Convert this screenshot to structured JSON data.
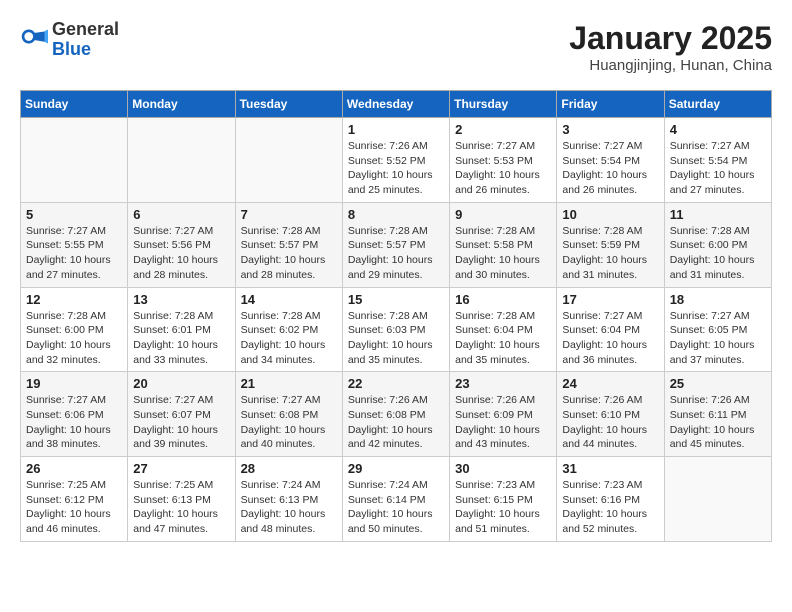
{
  "header": {
    "logo_general": "General",
    "logo_blue": "Blue",
    "title": "January 2025",
    "subtitle": "Huangjinjing, Hunan, China"
  },
  "weekdays": [
    "Sunday",
    "Monday",
    "Tuesday",
    "Wednesday",
    "Thursday",
    "Friday",
    "Saturday"
  ],
  "weeks": [
    [
      {
        "day": "",
        "sunrise": "",
        "sunset": "",
        "daylight": ""
      },
      {
        "day": "",
        "sunrise": "",
        "sunset": "",
        "daylight": ""
      },
      {
        "day": "",
        "sunrise": "",
        "sunset": "",
        "daylight": ""
      },
      {
        "day": "1",
        "sunrise": "Sunrise: 7:26 AM",
        "sunset": "Sunset: 5:52 PM",
        "daylight": "Daylight: 10 hours and 25 minutes."
      },
      {
        "day": "2",
        "sunrise": "Sunrise: 7:27 AM",
        "sunset": "Sunset: 5:53 PM",
        "daylight": "Daylight: 10 hours and 26 minutes."
      },
      {
        "day": "3",
        "sunrise": "Sunrise: 7:27 AM",
        "sunset": "Sunset: 5:54 PM",
        "daylight": "Daylight: 10 hours and 26 minutes."
      },
      {
        "day": "4",
        "sunrise": "Sunrise: 7:27 AM",
        "sunset": "Sunset: 5:54 PM",
        "daylight": "Daylight: 10 hours and 27 minutes."
      }
    ],
    [
      {
        "day": "5",
        "sunrise": "Sunrise: 7:27 AM",
        "sunset": "Sunset: 5:55 PM",
        "daylight": "Daylight: 10 hours and 27 minutes."
      },
      {
        "day": "6",
        "sunrise": "Sunrise: 7:27 AM",
        "sunset": "Sunset: 5:56 PM",
        "daylight": "Daylight: 10 hours and 28 minutes."
      },
      {
        "day": "7",
        "sunrise": "Sunrise: 7:28 AM",
        "sunset": "Sunset: 5:57 PM",
        "daylight": "Daylight: 10 hours and 28 minutes."
      },
      {
        "day": "8",
        "sunrise": "Sunrise: 7:28 AM",
        "sunset": "Sunset: 5:57 PM",
        "daylight": "Daylight: 10 hours and 29 minutes."
      },
      {
        "day": "9",
        "sunrise": "Sunrise: 7:28 AM",
        "sunset": "Sunset: 5:58 PM",
        "daylight": "Daylight: 10 hours and 30 minutes."
      },
      {
        "day": "10",
        "sunrise": "Sunrise: 7:28 AM",
        "sunset": "Sunset: 5:59 PM",
        "daylight": "Daylight: 10 hours and 31 minutes."
      },
      {
        "day": "11",
        "sunrise": "Sunrise: 7:28 AM",
        "sunset": "Sunset: 6:00 PM",
        "daylight": "Daylight: 10 hours and 31 minutes."
      }
    ],
    [
      {
        "day": "12",
        "sunrise": "Sunrise: 7:28 AM",
        "sunset": "Sunset: 6:00 PM",
        "daylight": "Daylight: 10 hours and 32 minutes."
      },
      {
        "day": "13",
        "sunrise": "Sunrise: 7:28 AM",
        "sunset": "Sunset: 6:01 PM",
        "daylight": "Daylight: 10 hours and 33 minutes."
      },
      {
        "day": "14",
        "sunrise": "Sunrise: 7:28 AM",
        "sunset": "Sunset: 6:02 PM",
        "daylight": "Daylight: 10 hours and 34 minutes."
      },
      {
        "day": "15",
        "sunrise": "Sunrise: 7:28 AM",
        "sunset": "Sunset: 6:03 PM",
        "daylight": "Daylight: 10 hours and 35 minutes."
      },
      {
        "day": "16",
        "sunrise": "Sunrise: 7:28 AM",
        "sunset": "Sunset: 6:04 PM",
        "daylight": "Daylight: 10 hours and 35 minutes."
      },
      {
        "day": "17",
        "sunrise": "Sunrise: 7:27 AM",
        "sunset": "Sunset: 6:04 PM",
        "daylight": "Daylight: 10 hours and 36 minutes."
      },
      {
        "day": "18",
        "sunrise": "Sunrise: 7:27 AM",
        "sunset": "Sunset: 6:05 PM",
        "daylight": "Daylight: 10 hours and 37 minutes."
      }
    ],
    [
      {
        "day": "19",
        "sunrise": "Sunrise: 7:27 AM",
        "sunset": "Sunset: 6:06 PM",
        "daylight": "Daylight: 10 hours and 38 minutes."
      },
      {
        "day": "20",
        "sunrise": "Sunrise: 7:27 AM",
        "sunset": "Sunset: 6:07 PM",
        "daylight": "Daylight: 10 hours and 39 minutes."
      },
      {
        "day": "21",
        "sunrise": "Sunrise: 7:27 AM",
        "sunset": "Sunset: 6:08 PM",
        "daylight": "Daylight: 10 hours and 40 minutes."
      },
      {
        "day": "22",
        "sunrise": "Sunrise: 7:26 AM",
        "sunset": "Sunset: 6:08 PM",
        "daylight": "Daylight: 10 hours and 42 minutes."
      },
      {
        "day": "23",
        "sunrise": "Sunrise: 7:26 AM",
        "sunset": "Sunset: 6:09 PM",
        "daylight": "Daylight: 10 hours and 43 minutes."
      },
      {
        "day": "24",
        "sunrise": "Sunrise: 7:26 AM",
        "sunset": "Sunset: 6:10 PM",
        "daylight": "Daylight: 10 hours and 44 minutes."
      },
      {
        "day": "25",
        "sunrise": "Sunrise: 7:26 AM",
        "sunset": "Sunset: 6:11 PM",
        "daylight": "Daylight: 10 hours and 45 minutes."
      }
    ],
    [
      {
        "day": "26",
        "sunrise": "Sunrise: 7:25 AM",
        "sunset": "Sunset: 6:12 PM",
        "daylight": "Daylight: 10 hours and 46 minutes."
      },
      {
        "day": "27",
        "sunrise": "Sunrise: 7:25 AM",
        "sunset": "Sunset: 6:13 PM",
        "daylight": "Daylight: 10 hours and 47 minutes."
      },
      {
        "day": "28",
        "sunrise": "Sunrise: 7:24 AM",
        "sunset": "Sunset: 6:13 PM",
        "daylight": "Daylight: 10 hours and 48 minutes."
      },
      {
        "day": "29",
        "sunrise": "Sunrise: 7:24 AM",
        "sunset": "Sunset: 6:14 PM",
        "daylight": "Daylight: 10 hours and 50 minutes."
      },
      {
        "day": "30",
        "sunrise": "Sunrise: 7:23 AM",
        "sunset": "Sunset: 6:15 PM",
        "daylight": "Daylight: 10 hours and 51 minutes."
      },
      {
        "day": "31",
        "sunrise": "Sunrise: 7:23 AM",
        "sunset": "Sunset: 6:16 PM",
        "daylight": "Daylight: 10 hours and 52 minutes."
      },
      {
        "day": "",
        "sunrise": "",
        "sunset": "",
        "daylight": ""
      }
    ]
  ]
}
